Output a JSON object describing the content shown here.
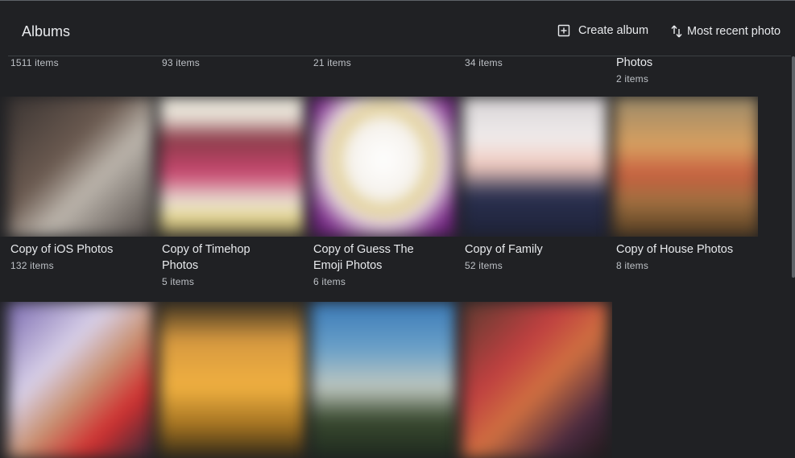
{
  "header": {
    "title": "Albums",
    "create_label": "Create album",
    "sort_label": "Most recent photo"
  },
  "row1": [
    {
      "name": "",
      "count": "1511 items"
    },
    {
      "name": "",
      "count": "93 items"
    },
    {
      "name": "",
      "count": "21 items"
    },
    {
      "name": "",
      "count": "34 items"
    },
    {
      "name": "Photos",
      "count": "2 items"
    }
  ],
  "row2": [
    {
      "name": "Copy of iOS Photos",
      "count": "132 items"
    },
    {
      "name": "Copy of Timehop Photos",
      "count": "5 items"
    },
    {
      "name": "Copy of Guess The Emoji Photos",
      "count": "6 items"
    },
    {
      "name": "Copy of Family",
      "count": "52 items"
    },
    {
      "name": "Copy of House Photos",
      "count": "8 items"
    }
  ],
  "colors": {
    "background": "#202124",
    "text": "#e8eaed",
    "subtext": "#bdc1c6"
  }
}
